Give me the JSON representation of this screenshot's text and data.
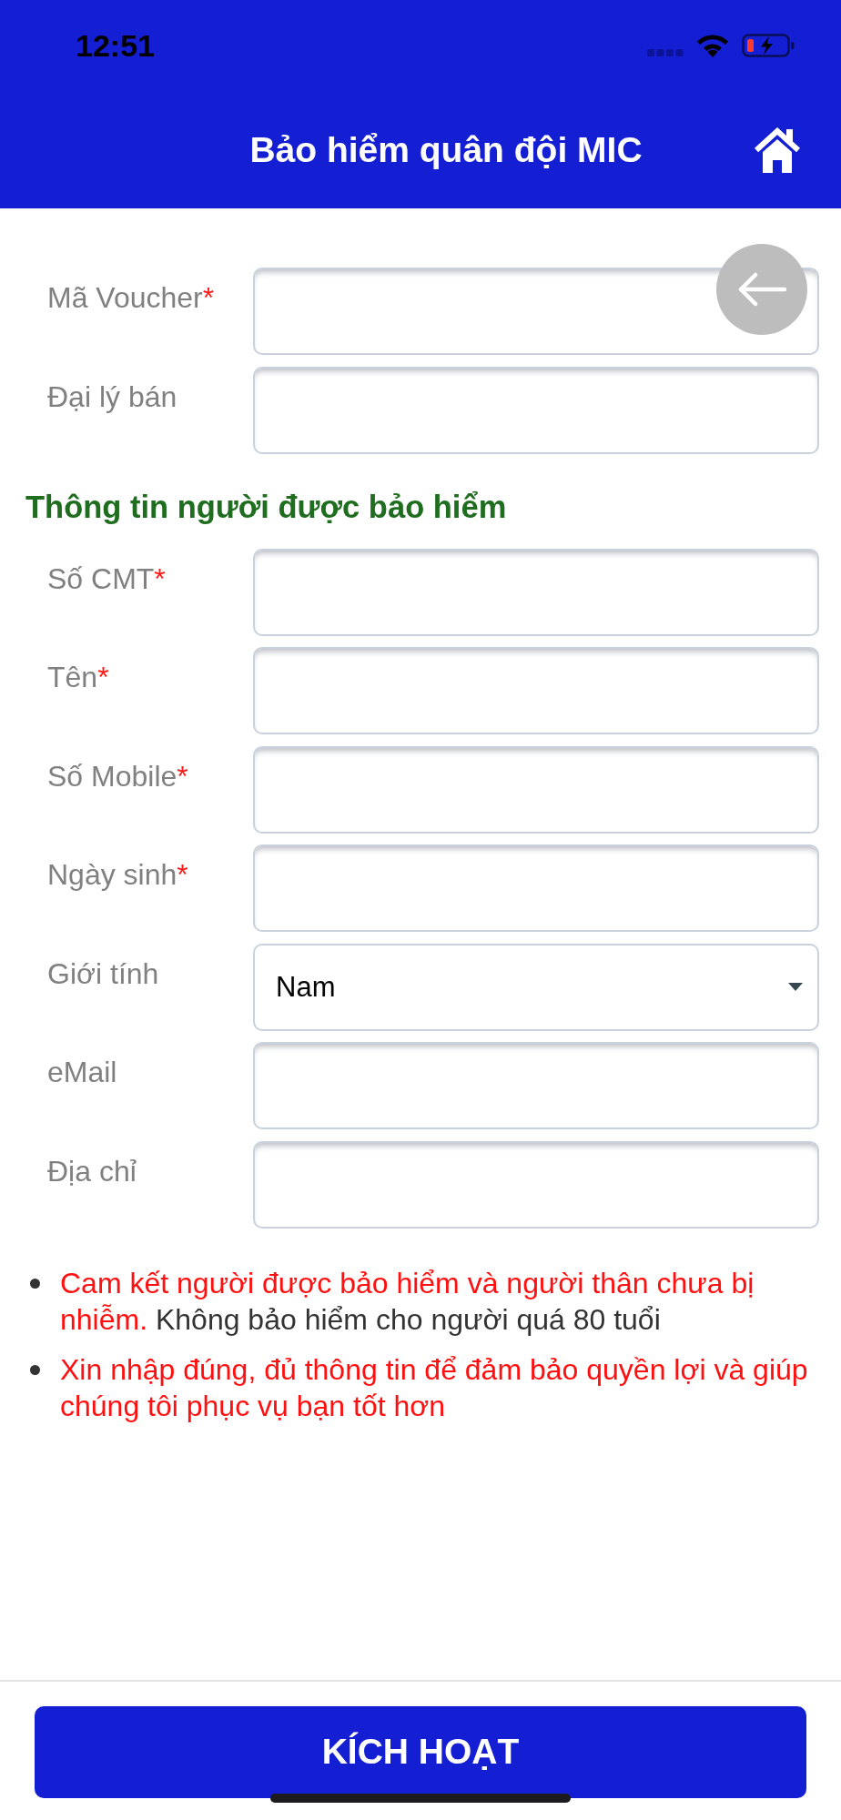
{
  "status_bar": {
    "time": "12:51"
  },
  "header": {
    "title": "Bảo hiểm quân đội MIC"
  },
  "voucher_fields": [
    {
      "kind": "text",
      "label": "Mã Voucher",
      "required_mark": "*"
    },
    {
      "kind": "text",
      "label": "Đại lý bán"
    }
  ],
  "insured_section": {
    "heading": "Thông tin người được bảo hiểm",
    "fields": [
      {
        "kind": "text",
        "label": "Số CMT",
        "required_mark": "*"
      },
      {
        "kind": "text",
        "label": "Tên",
        "required_mark": "*"
      },
      {
        "kind": "text",
        "label": "Số Mobile",
        "required_mark": "*"
      },
      {
        "kind": "text",
        "label": "Ngày sinh",
        "required_mark": "*"
      },
      {
        "kind": "select",
        "label": "Giới tính",
        "value": "Nam"
      },
      {
        "kind": "text",
        "label": "eMail"
      },
      {
        "kind": "text",
        "label": "Địa chỉ"
      }
    ]
  },
  "notes": [
    {
      "parts": [
        {
          "text": "Cam kết người được bảo hiểm và người thân chưa bị nhiễm.",
          "emphasis": true
        },
        {
          "text": "Không bảo hiểm cho người quá 80 tuổi",
          "emphasis": false
        }
      ]
    },
    {
      "parts": [
        {
          "text": "Xin nhập đúng, đủ thông tin để đảm bảo quyền lợi và giúp chúng tôi phục vụ bạn tốt hơn",
          "emphasis": true
        }
      ]
    }
  ],
  "activate_button": {
    "label": "KÍCH HOẠT"
  }
}
